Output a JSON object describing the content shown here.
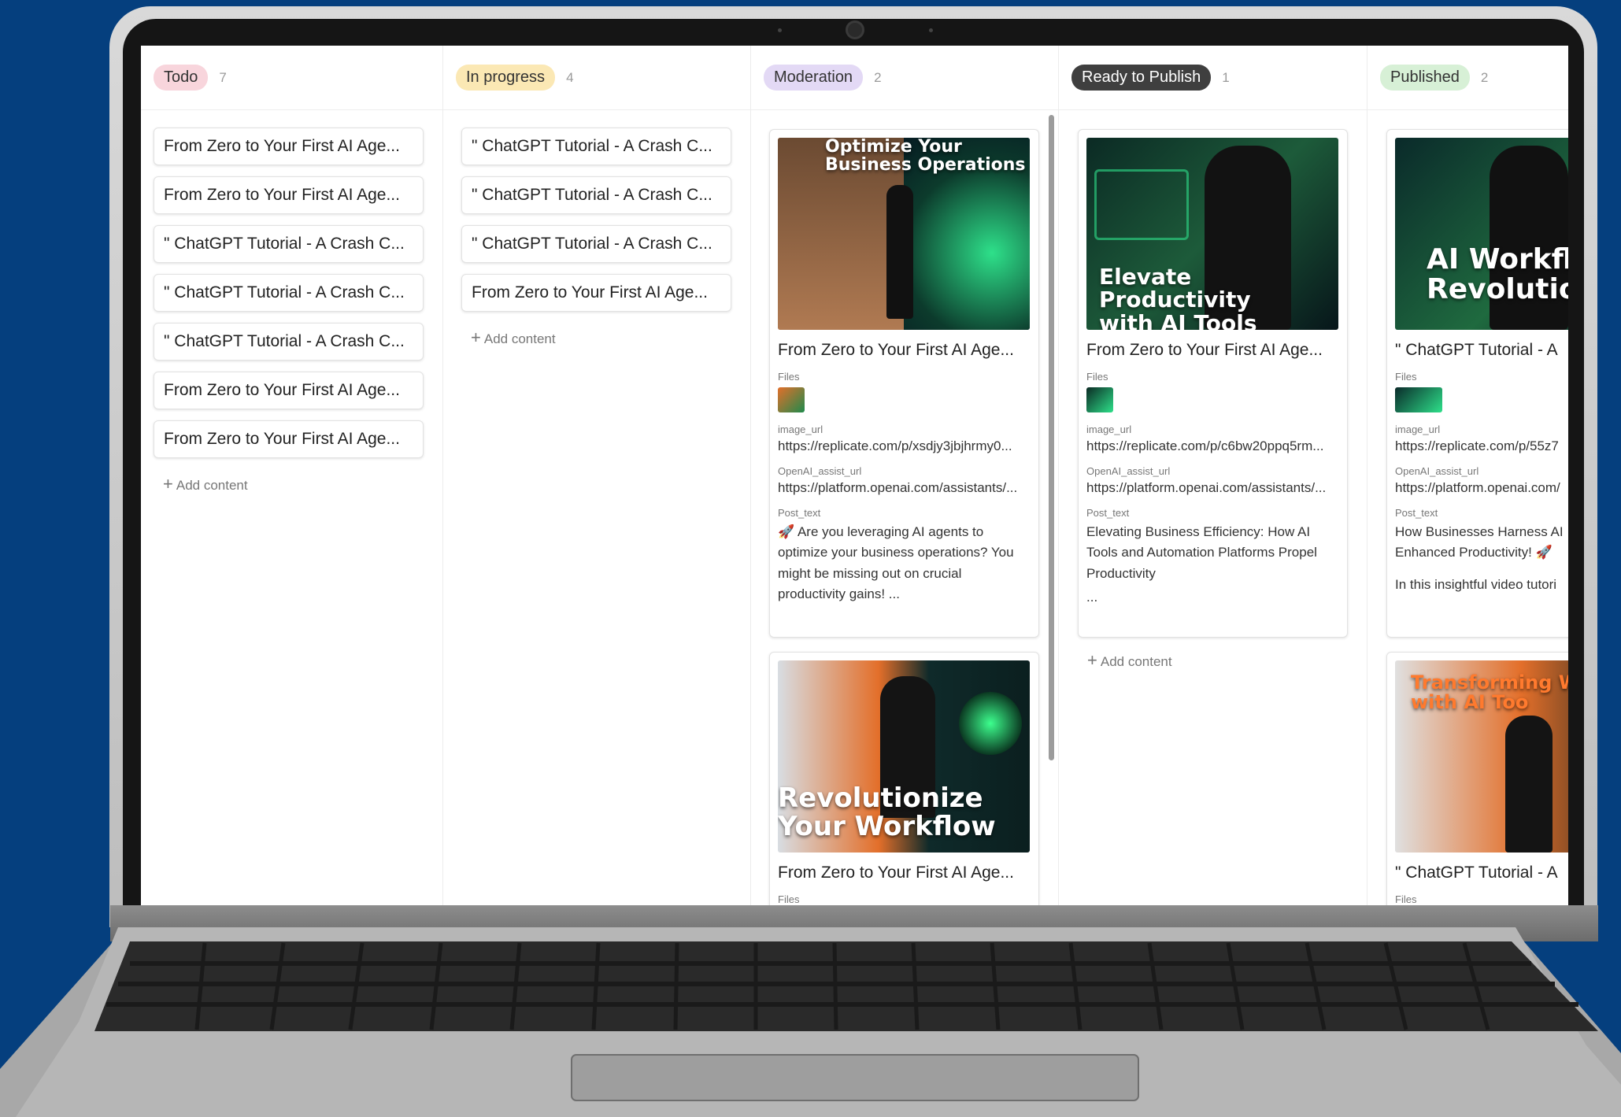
{
  "board": {
    "columns": [
      {
        "label": "Todo",
        "count": "7",
        "cards": [
          "From Zero to Your First AI Age...",
          "From Zero to Your First AI Age...",
          "\" ChatGPT Tutorial - A Crash C...",
          "\" ChatGPT Tutorial - A Crash C...",
          "\" ChatGPT Tutorial - A Crash C...",
          "From Zero to Your First AI Age...",
          "From Zero to Your First AI Age..."
        ],
        "add_label": "Add content"
      },
      {
        "label": "In progress",
        "count": "4",
        "cards": [
          "\" ChatGPT Tutorial - A Crash C...",
          "\" ChatGPT Tutorial - A Crash C...",
          "\" ChatGPT Tutorial - A Crash C...",
          "From Zero to Your First AI Age..."
        ],
        "add_label": "Add content"
      },
      {
        "label": "Moderation",
        "count": "2",
        "cards": [
          {
            "image_caption": "Optimize Your\nBusiness Operations",
            "title": "From Zero to Your First AI Age...",
            "files_label": "Files",
            "image_url_label": "image_url",
            "image_url": "https://replicate.com/p/xsdjy3jbjhrmy0...",
            "openai_label": "OpenAI_assist_url",
            "openai_url": "https://platform.openai.com/assistants/...",
            "post_label": "Post_text",
            "post_text": "🚀 Are you leveraging AI agents to optimize your business operations? You might be missing out on crucial productivity gains!  ..."
          },
          {
            "image_caption": "Revolutionize\nYour Workflow",
            "title": "From Zero to Your First AI Age...",
            "files_label": "Files"
          }
        ]
      },
      {
        "label": "Ready to Publish",
        "count": "1",
        "cards": [
          {
            "image_caption": "Elevate\nProductivity\nwith AI Tools",
            "title": "From Zero to Your First AI Age...",
            "files_label": "Files",
            "image_url_label": "image_url",
            "image_url": "https://replicate.com/p/c6bw20ppq5rm...",
            "openai_label": "OpenAI_assist_url",
            "openai_url": "https://platform.openai.com/assistants/...",
            "post_label": "Post_text",
            "post_text": "Elevating Business Efficiency: How AI Tools and Automation Platforms Propel Productivity",
            "post_more": "..."
          }
        ],
        "add_label": "Add content"
      },
      {
        "label": "Published",
        "count": "2",
        "cards": [
          {
            "image_caption": "AI Workflow\nRevolution",
            "title": "\" ChatGPT Tutorial - A",
            "files_label": "Files",
            "image_url_label": "image_url",
            "image_url": "https://replicate.com/p/55z7",
            "openai_label": "OpenAI_assist_url",
            "openai_url": "https://platform.openai.com/",
            "post_label": "Post_text",
            "post_text": "How Businesses Harness AI Enhanced Productivity! 🚀",
            "post_more": "In this insightful video tutori"
          },
          {
            "image_caption": "Transforming W\nwith AI Too",
            "title": "\" ChatGPT Tutorial - A",
            "files_label": "Files"
          }
        ]
      }
    ]
  },
  "colors": {
    "background": "#053f7e",
    "todo": "#f8d5dc",
    "in_progress": "#fbe8b4",
    "moderation": "#e3d9f5",
    "ready": "#3f3f3f",
    "published": "#d7f0d6"
  },
  "icons": [
    "plus-icon",
    "webcam-icon"
  ]
}
